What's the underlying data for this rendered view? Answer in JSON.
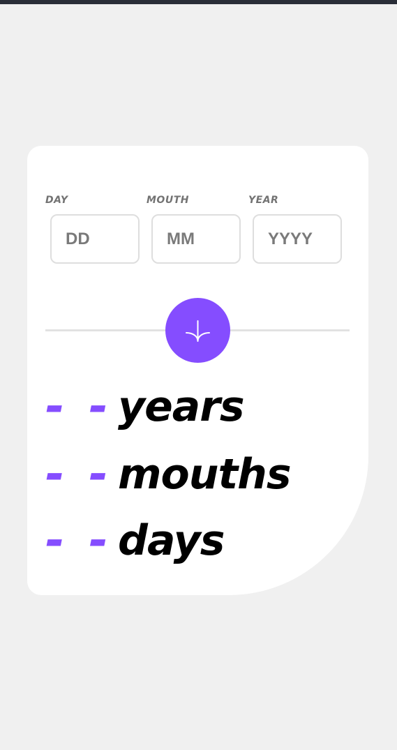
{
  "form": {
    "fields": [
      {
        "label": "DAY",
        "placeholder": "DD",
        "value": ""
      },
      {
        "label": "MOUTH",
        "placeholder": "MM",
        "value": ""
      },
      {
        "label": "YEAR",
        "placeholder": "YYYY",
        "value": ""
      }
    ]
  },
  "submit": {
    "icon": "arrow-down-icon",
    "color": "#854dff"
  },
  "results": [
    {
      "value": "- -",
      "unit": "years"
    },
    {
      "value": "- -",
      "unit": "mouths"
    },
    {
      "value": "- -",
      "unit": "days"
    }
  ],
  "colors": {
    "accent": "#854dff",
    "background": "#f0f0f0",
    "card": "#ffffff",
    "label": "#737373",
    "border": "#dedede"
  }
}
